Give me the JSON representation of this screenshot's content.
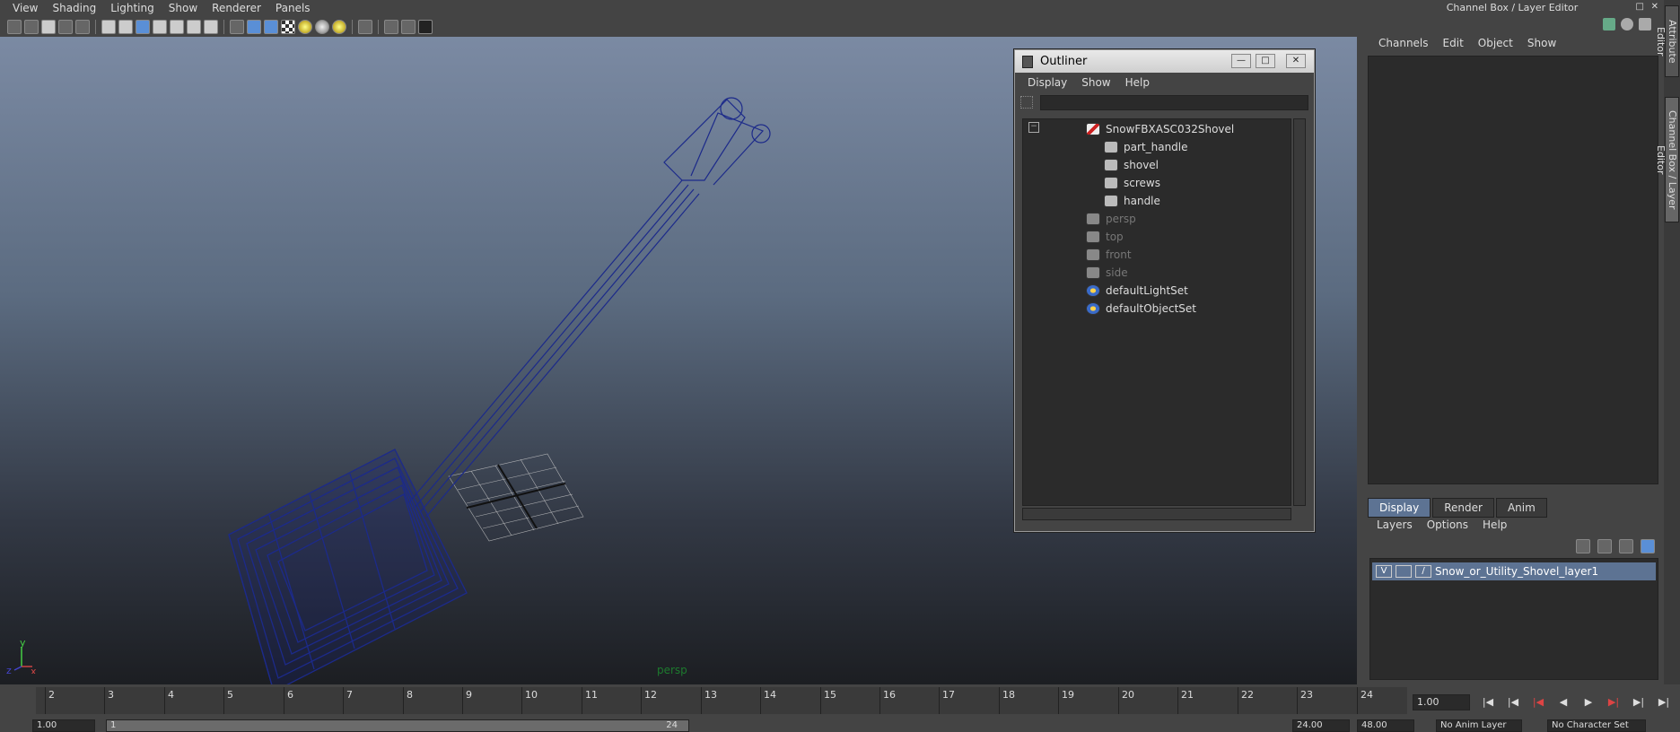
{
  "menubar": {
    "items": [
      "View",
      "Shading",
      "Lighting",
      "Show",
      "Renderer",
      "Panels"
    ]
  },
  "viewport": {
    "camera_label": "persp",
    "axis_y": "y",
    "axis_x": "x",
    "axis_z": "z"
  },
  "outliner": {
    "title": "Outliner",
    "menu": [
      "Display",
      "Show",
      "Help"
    ],
    "items": [
      {
        "label": "SnowFBXASC032Shovel",
        "icon": "group-icon",
        "dim": false
      },
      {
        "label": "part_handle",
        "icon": "mesh-icon",
        "dim": false
      },
      {
        "label": "shovel",
        "icon": "mesh-icon",
        "dim": false
      },
      {
        "label": "screws",
        "icon": "mesh-icon",
        "dim": false
      },
      {
        "label": "handle",
        "icon": "mesh-icon",
        "dim": false
      },
      {
        "label": "persp",
        "icon": "camera-icon",
        "dim": true
      },
      {
        "label": "top",
        "icon": "camera-icon",
        "dim": true
      },
      {
        "label": "front",
        "icon": "camera-icon",
        "dim": true
      },
      {
        "label": "side",
        "icon": "camera-icon",
        "dim": true
      },
      {
        "label": "defaultLightSet",
        "icon": "set-icon",
        "dim": false
      },
      {
        "label": "defaultObjectSet",
        "icon": "set-icon",
        "dim": false
      }
    ]
  },
  "channel_box": {
    "title": "Channel Box / Layer Editor",
    "menu": [
      "Channels",
      "Edit",
      "Object",
      "Show"
    ],
    "tabs": [
      "Display",
      "Render",
      "Anim"
    ],
    "layer_menu": [
      "Layers",
      "Options",
      "Help"
    ],
    "layer": {
      "visible": "V",
      "name": "Snow_or_Utility_Shovel_layer1"
    },
    "side_tabs": [
      "Attribute Editor",
      "Channel Box / Layer Editor"
    ]
  },
  "timeline": {
    "ticks": [
      "2",
      "3",
      "4",
      "5",
      "6",
      "7",
      "8",
      "9",
      "10",
      "11",
      "12",
      "13",
      "14",
      "15",
      "16",
      "17",
      "18",
      "19",
      "20",
      "21",
      "22",
      "23",
      "24"
    ],
    "current_frame": "1.00"
  },
  "range": {
    "start": "1.00",
    "range_start": "1",
    "range_end": "24",
    "end": "24.00",
    "max": "48.00",
    "anim_layer": "No Anim Layer",
    "char_set": "No Character Set"
  }
}
